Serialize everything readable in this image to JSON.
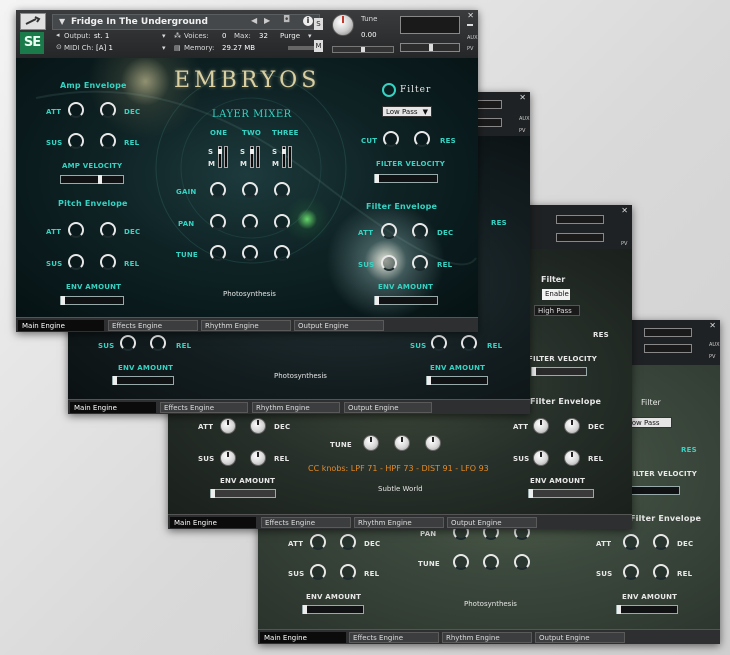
{
  "header": {
    "instrument_name": "Fridge In The Underground",
    "output_label": "Output:",
    "output_value": "st. 1",
    "midi_label": "MIDI Ch:",
    "midi_value": "[A]  1",
    "voices_label": "Voices:",
    "voices_value": "0",
    "max_label": "Max:",
    "max_value": "32",
    "memory_label": "Memory:",
    "memory_value": "29.27 MB",
    "purge_label": "Purge",
    "tune_label": "Tune",
    "tune_value": "0.00",
    "s_label": "S",
    "m_label": "M",
    "aux_label": "AUX",
    "pv_label": "PV",
    "se_logo": "SE"
  },
  "logo": "EMBRYOS",
  "amp": {
    "title": "Amp Envelope",
    "att": "ATT",
    "dec": "DEC",
    "sus": "SUS",
    "rel": "REL",
    "velocity_label": "AMP VELOCITY"
  },
  "pitch": {
    "title": "Pitch Envelope",
    "att": "ATT",
    "dec": "DEC",
    "sus": "SUS",
    "rel": "REL",
    "env_amount": "ENV AMOUNT"
  },
  "mixer": {
    "title": "LAYER MIXER",
    "one": "ONE",
    "two": "TWO",
    "three": "THREE",
    "s": "S",
    "m": "M",
    "gain": "GAIN",
    "pan": "PAN",
    "tune": "TUNE"
  },
  "filter": {
    "title": "Filter",
    "type": "Low Pass",
    "cut": "CUT",
    "res": "RES",
    "velocity_label": "FILTER VELOCITY",
    "env_title": "Filter Envelope",
    "att": "ATT",
    "dec": "DEC",
    "sus": "SUS",
    "rel": "REL",
    "env_amount": "ENV AMOUNT"
  },
  "preset_name_1": "Photosynthesis",
  "preset_name_3": "Subtle World",
  "cc_knobs": "CC knobs: LPF 71 - HPF 73 - DIST 91 - LFO 93",
  "filter_3": {
    "title": "Filter",
    "enable": "Enable",
    "type": "High Pass"
  },
  "tabs": {
    "main": "Main Engine",
    "effects": "Effects Engine",
    "rhythm": "Rhythm Engine",
    "output": "Output Engine"
  },
  "colors": {
    "accent_teal": "#36d3c3",
    "logo_gold": "#d9cfa1",
    "bg_dark": "#1b1f22"
  }
}
